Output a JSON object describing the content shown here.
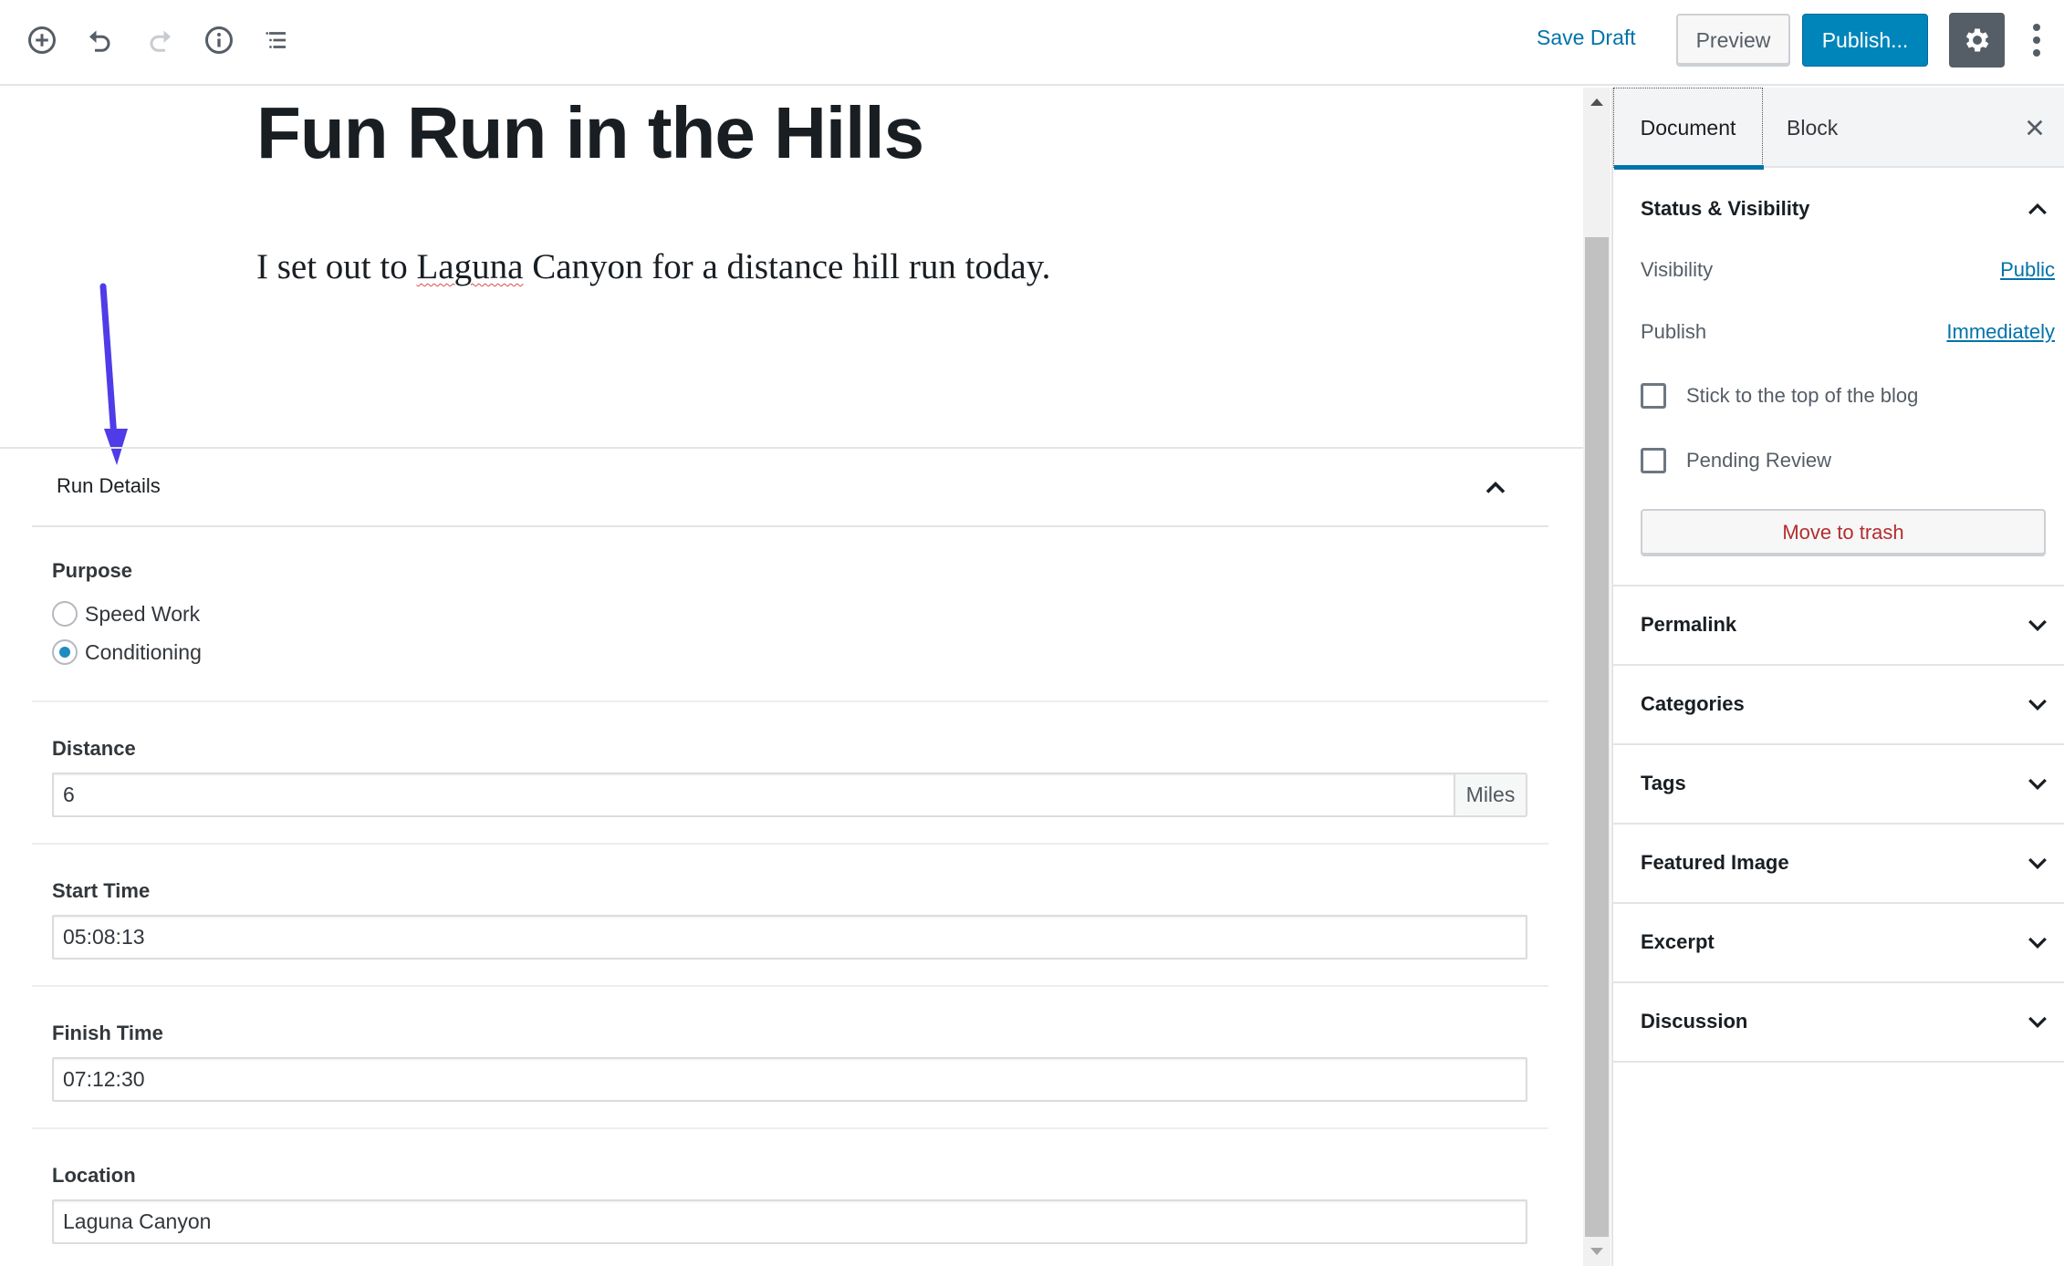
{
  "toolbar": {
    "icons": [
      "add-block-icon",
      "undo-icon",
      "redo-icon",
      "info-icon",
      "block-navigation-icon"
    ],
    "save_draft": "Save Draft",
    "preview": "Preview",
    "publish": "Publish...",
    "settings_icon": "gear-icon",
    "more_icon": "kebab-menu-icon"
  },
  "colors": {
    "accent": "#0085ba",
    "link": "#0073aa",
    "danger": "#b32d2e",
    "annotation_arrow": "#4f3ce8"
  },
  "post": {
    "title": "Fun Run in the Hills",
    "paragraph_before": "I set out to ",
    "paragraph_misspelled": "Laguna",
    "paragraph_after": " Canyon for a distance hill run today."
  },
  "metabox": {
    "title": "Run Details",
    "purpose": {
      "label": "Purpose",
      "options": [
        {
          "label": "Speed Work",
          "checked": false
        },
        {
          "label": "Conditioning",
          "checked": true
        }
      ]
    },
    "distance": {
      "label": "Distance",
      "value": "6",
      "unit": "Miles"
    },
    "start_time": {
      "label": "Start Time",
      "value": "05:08:13"
    },
    "finish_time": {
      "label": "Finish Time",
      "value": "07:12:30"
    },
    "location": {
      "label": "Location",
      "value": "Laguna Canyon"
    }
  },
  "sidebar": {
    "tabs": [
      {
        "label": "Document",
        "active": true
      },
      {
        "label": "Block",
        "active": false
      }
    ],
    "status_visibility": {
      "title": "Status & Visibility",
      "visibility_label": "Visibility",
      "visibility_value": "Public",
      "publish_label": "Publish",
      "publish_value": "Immediately",
      "sticky_label": "Stick to the top of the blog",
      "sticky_checked": false,
      "pending_label": "Pending Review",
      "pending_checked": false,
      "trash_label": "Move to trash"
    },
    "panels": [
      {
        "title": "Permalink"
      },
      {
        "title": "Categories"
      },
      {
        "title": "Tags"
      },
      {
        "title": "Featured Image"
      },
      {
        "title": "Excerpt"
      },
      {
        "title": "Discussion"
      }
    ]
  }
}
